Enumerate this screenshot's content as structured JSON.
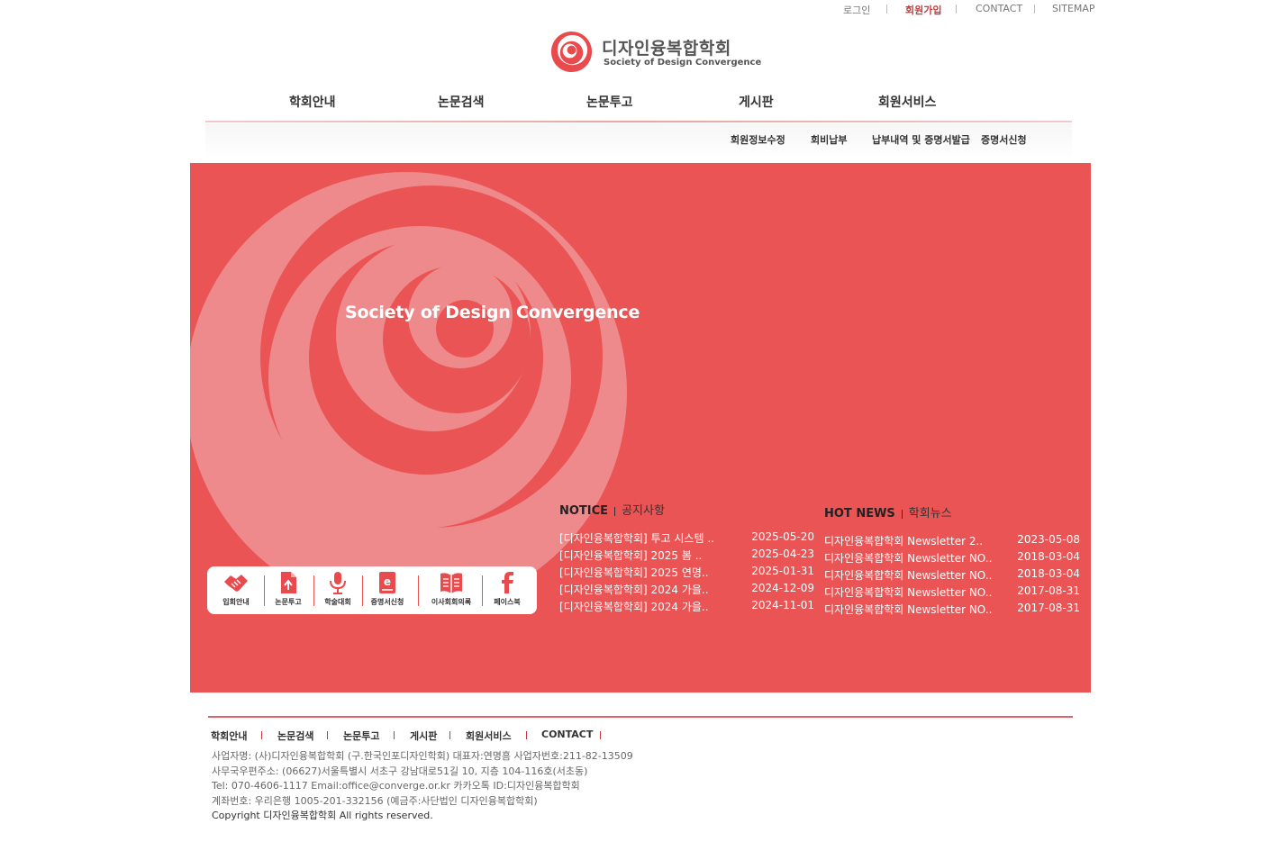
{
  "util": {
    "login": "로그인",
    "join": "회원가입",
    "contact": "CONTACT",
    "sitemap": "SITEMAP"
  },
  "logo": {
    "ko": "디자인융복합학회",
    "en": "Society of Design Convergence"
  },
  "gnb": [
    "학회안내",
    "논문검색",
    "논문투고",
    "게시판",
    "회원서비스"
  ],
  "submenu": [
    "회원정보수정",
    "회비납부",
    "납부내역 및 증명서발급",
    "증명서신청"
  ],
  "hero": {
    "tagline": "Society of Design Convergence",
    "bg_color": "#ea5455"
  },
  "quick": [
    {
      "label": "입회안내",
      "icon": "handshake-icon"
    },
    {
      "label": "논문투고",
      "icon": "document-upload-icon"
    },
    {
      "label": "학술대회",
      "icon": "microphone-icon"
    },
    {
      "label": "증명서신청",
      "icon": "certificate-e-icon"
    },
    {
      "label": "이사회회의록",
      "icon": "book-icon"
    },
    {
      "label": "페이스북",
      "icon": "facebook-icon"
    }
  ],
  "notice": {
    "title_en": "NOTICE",
    "title_ko": "공지사항",
    "items": [
      {
        "title": "[디자인융복합학회] 투고 시스템 ..",
        "date": "2025-05-20"
      },
      {
        "title": "[디자인융복합학회] 2025 봄 ..",
        "date": "2025-04-23"
      },
      {
        "title": "[디자인융복합학회] 2025 연명..",
        "date": "2025-01-31"
      },
      {
        "title": "[디자인융복합학회] 2024 가을..",
        "date": "2024-12-09"
      },
      {
        "title": "[디자인융복합학회] 2024 가을..",
        "date": "2024-11-01"
      }
    ]
  },
  "news": {
    "title_en": "HOT NEWS",
    "title_ko": "학회뉴스",
    "items": [
      {
        "title": "디자인융복합학회 Newsletter 2..",
        "date": "2023-05-08"
      },
      {
        "title": "디자인융복합학회 Newsletter NO..",
        "date": "2018-03-04"
      },
      {
        "title": "디자인융복합학회 Newsletter NO..",
        "date": "2018-03-04"
      },
      {
        "title": "디자인융복합학회 Newsletter NO..",
        "date": "2017-08-31"
      },
      {
        "title": "디자인융복합학회 Newsletter NO..",
        "date": "2017-08-31"
      }
    ]
  },
  "footer": {
    "nav": [
      "학회안내",
      "논문검색",
      "논문투고",
      "게시판",
      "회원서비스",
      "CONTACT"
    ],
    "info": [
      "사업자명: (사)디자인융복합학회 (구.한국인포디자인학회) 대표자:연명흠 사업자번호:211-82-13509",
      "사무국우편주소: (06627)서울특별시 서초구 강남대로51길 10, 지층 104-116호(서초동)",
      "Tel: 070-4606-1117 Email:office@converge.or.kr 카카오톡 ID:디자인융복합학회",
      "계좌번호: 우리은행 1005-201-332156 (예금주:사단법인 디자인융복합학회)"
    ],
    "copyright": "Copyright 디자인융복합학회 All rights reserved."
  }
}
